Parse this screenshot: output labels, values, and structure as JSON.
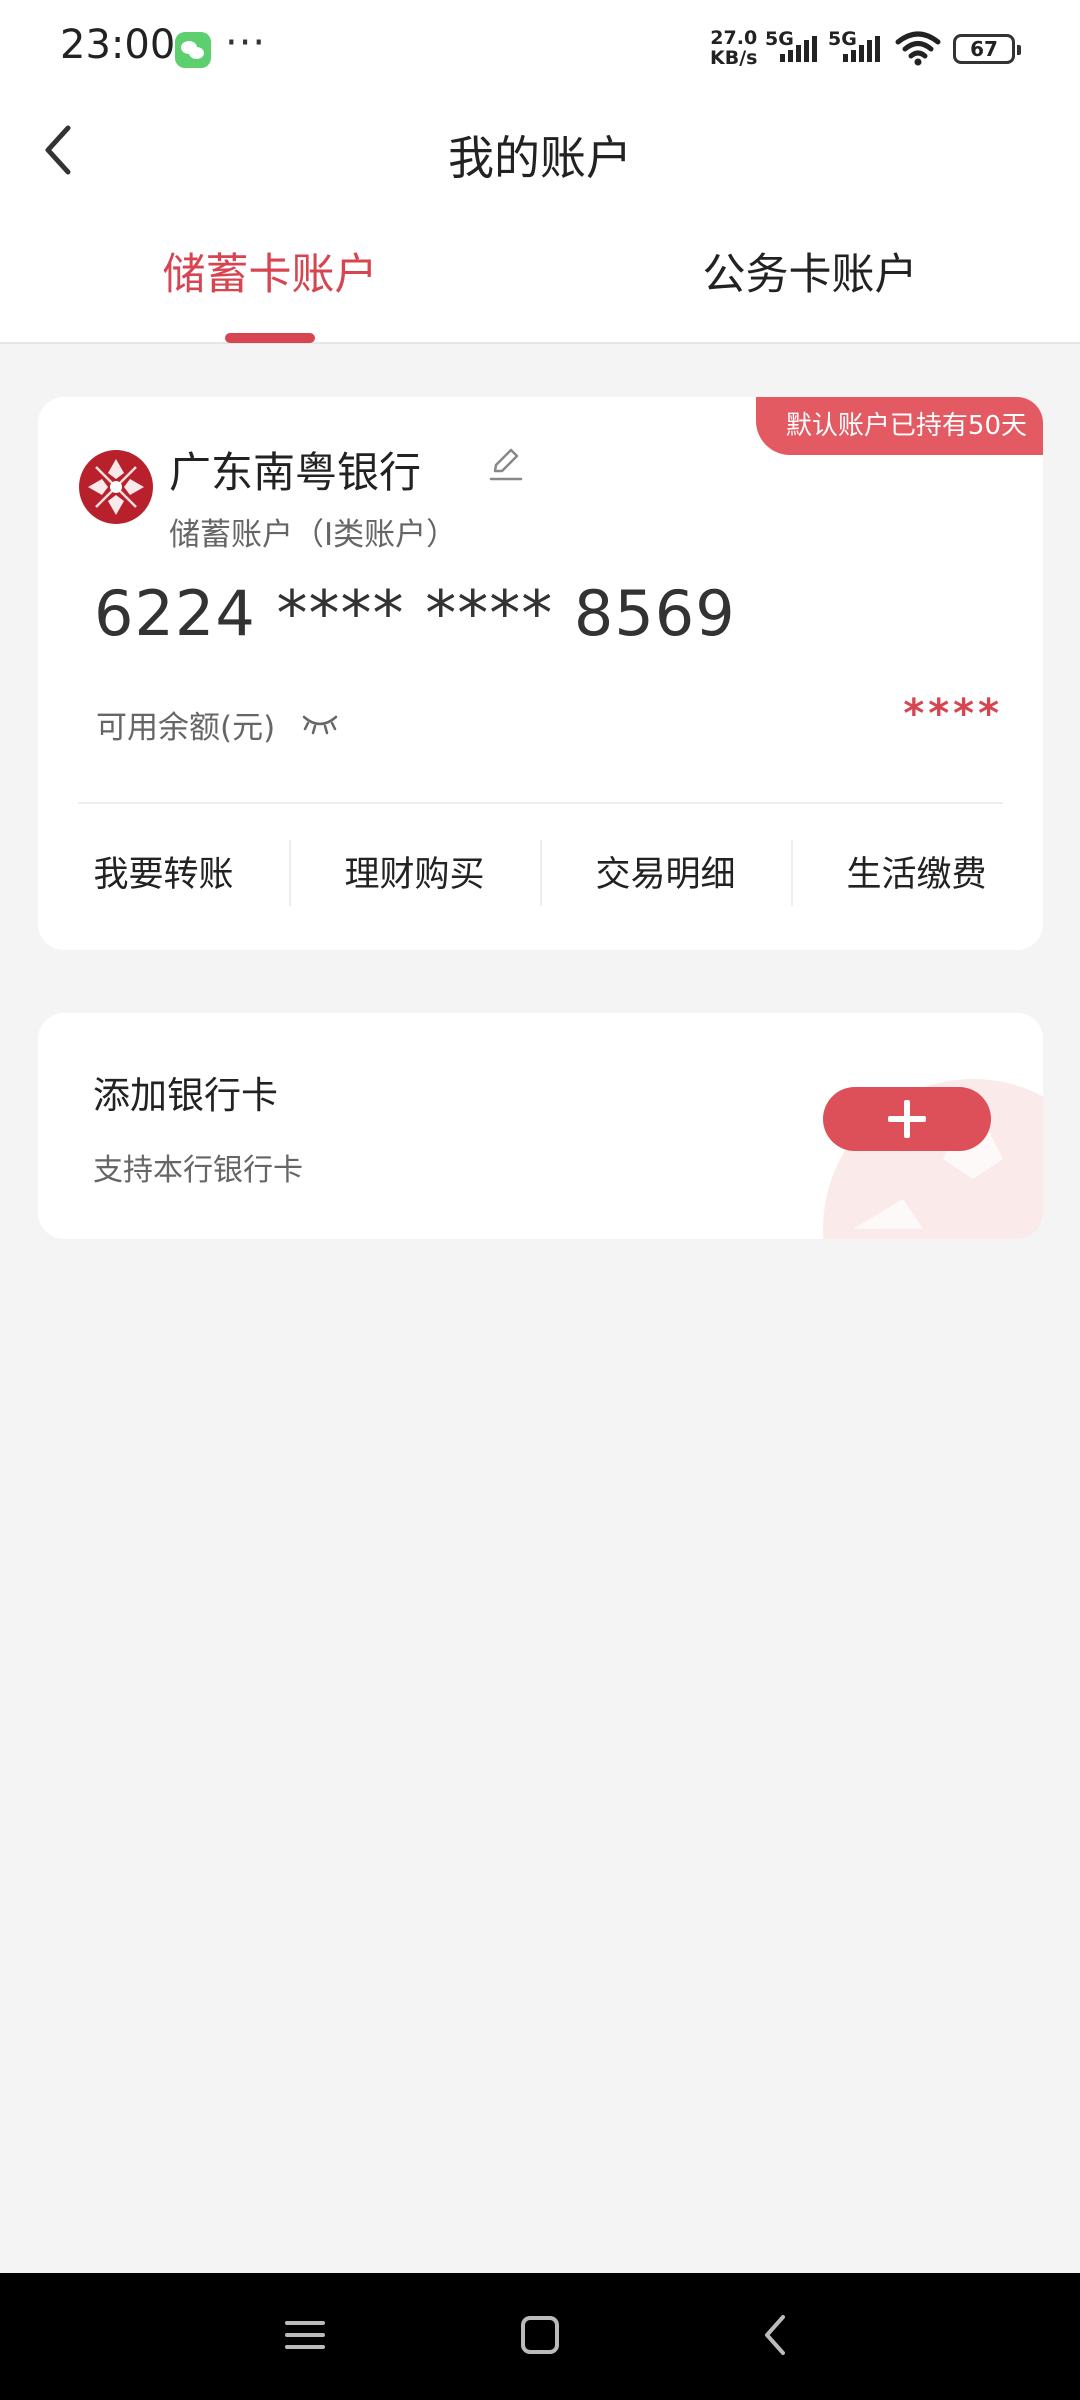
{
  "status_bar": {
    "time": "23:00",
    "more": "···",
    "net_speed_value": "27.0",
    "net_speed_unit": "KB/s",
    "sim1": "5G",
    "sim2": "5G",
    "battery": "67"
  },
  "header": {
    "title": "我的账户"
  },
  "tabs": [
    {
      "label": "储蓄卡账户",
      "active": true
    },
    {
      "label": "公务卡账户",
      "active": false
    }
  ],
  "account_card": {
    "badge": "默认账户已持有50天",
    "bank_name": "广东南粤银行",
    "account_type": "储蓄账户（I类账户）",
    "card_number": "6224 **** **** 8569",
    "balance_label": "可用余额(元)",
    "balance_value": "****",
    "actions": [
      "我要转账",
      "理财购买",
      "交易明细",
      "生活缴费"
    ]
  },
  "add_card": {
    "title": "添加银行卡",
    "subtitle": "支持本行银行卡"
  },
  "colors": {
    "accent": "#d64550",
    "badge": "#e45a63",
    "add_button": "#dd4f59",
    "logo": "#b8212b",
    "background": "#f4f4f4",
    "nav_bar": "#000000"
  },
  "icons": {
    "back": "chevron-left-icon",
    "edit": "pencil-icon",
    "eye": "eye-closed-icon",
    "add": "plus-icon",
    "nav_menu": "menu-icon",
    "nav_home": "home-icon",
    "nav_back": "back-icon"
  }
}
